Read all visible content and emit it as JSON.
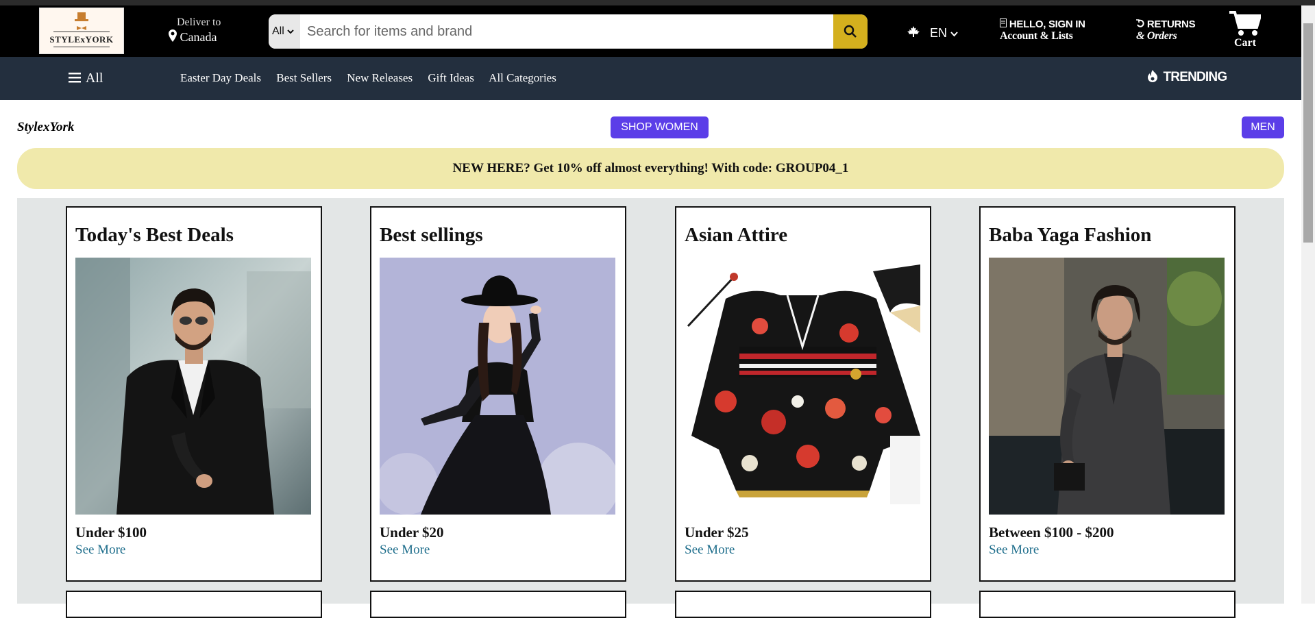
{
  "header": {
    "logo_text": "STYLExYORK",
    "deliver_label": "Deliver to",
    "deliver_location": "Canada",
    "search_category": "All",
    "search_placeholder": "Search for items and brand",
    "language": "EN",
    "account_line1": "HELLO, SIGN IN",
    "account_line2": "Account & Lists",
    "returns_line1": "RETURNS",
    "returns_line2": "& Orders",
    "cart_label": "Cart"
  },
  "nav": {
    "all_label": "All",
    "links": [
      "Easter Day Deals",
      "Best Sellers",
      "New Releases",
      "Gift Ideas",
      "All Categories"
    ],
    "trending_label": "TRENDING"
  },
  "subheader": {
    "brand": "StylexYork",
    "shop_women": "SHOP WOMEN",
    "men": "MEN"
  },
  "promo": {
    "text": "NEW HERE? Get 10% off almost everything! With code: GROUP04_1"
  },
  "cards": [
    {
      "title": "Today's Best Deals",
      "caption": "Under $100",
      "link": "See More",
      "image": "man-in-black-suit-photo"
    },
    {
      "title": "Best sellings",
      "caption": "Under $20",
      "link": "See More",
      "image": "woman-in-black-lace-dress-photo"
    },
    {
      "title": "Asian Attire",
      "caption": "Under $25",
      "link": "See More",
      "image": "floral-kimono-photo"
    },
    {
      "title": "Baba Yaga Fashion",
      "caption": "Between $100 - $200",
      "link": "See More",
      "image": "man-in-grey-suit-photo"
    }
  ],
  "colors": {
    "header_bg": "#000000",
    "nav_bg": "#232f3e",
    "search_button": "#d4b01e",
    "accent_button": "#5b3ee8",
    "promo_bg": "#f0e9ab",
    "link": "#1f6e8c"
  }
}
